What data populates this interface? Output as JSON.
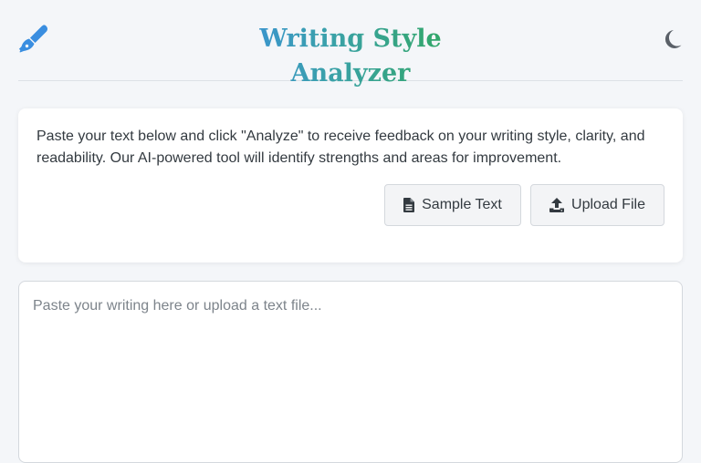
{
  "header": {
    "title": "Writing Style Analyzer",
    "logo_icon": "pen-nib-icon",
    "theme_toggle_icon": "moon-icon",
    "accent_blue": "#3a8ee0",
    "accent_green": "#2fa84f"
  },
  "intro": {
    "description": "Paste your text below and click \"Analyze\" to receive feedback on your writing style, clarity, and readability. Our AI-powered tool will identify strengths and areas for improvement.",
    "buttons": {
      "sample_label": "Sample Text",
      "sample_icon": "file-icon",
      "upload_label": "Upload File",
      "upload_icon": "upload-icon"
    }
  },
  "editor": {
    "placeholder": "Paste your writing here or upload a text file...",
    "value": ""
  }
}
